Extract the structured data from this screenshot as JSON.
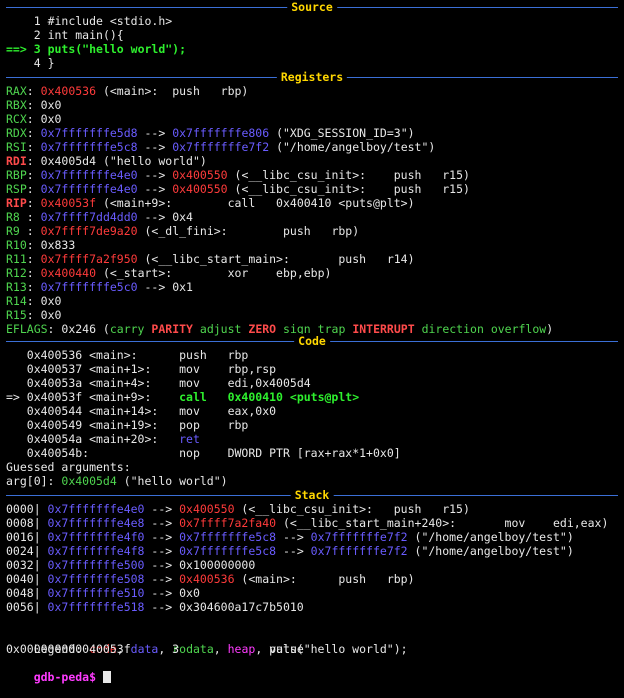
{
  "headers": {
    "source": "Source",
    "registers": "Registers",
    "code": "Code",
    "stack": "Stack"
  },
  "source_lines": [
    {
      "arrow": "",
      "num": "1",
      "text": "#include <stdio.h>"
    },
    {
      "arrow": "",
      "num": "2",
      "text": "int main(){"
    },
    {
      "arrow": "==> ",
      "num": "3",
      "text": "puts(\"hello world\");"
    },
    {
      "arrow": "",
      "num": "4",
      "text": "}"
    }
  ],
  "registers": [
    {
      "name": "RAX",
      "parts": [
        {
          "t": "0x400536",
          "c": "r"
        },
        {
          "t": " (<main>:  push   rbp)",
          "c": "w"
        }
      ]
    },
    {
      "name": "RBX",
      "parts": [
        {
          "t": "0x0",
          "c": "w"
        }
      ]
    },
    {
      "name": "RCX",
      "parts": [
        {
          "t": "0x0",
          "c": "w"
        }
      ]
    },
    {
      "name": "RDX",
      "parts": [
        {
          "t": "0x7fffffffe5d8",
          "c": "b"
        },
        {
          "t": " --> ",
          "c": "w"
        },
        {
          "t": "0x7fffffffe806",
          "c": "b"
        },
        {
          "t": " (\"XDG_SESSION_ID=3\")",
          "c": "w"
        }
      ]
    },
    {
      "name": "RSI",
      "parts": [
        {
          "t": "0x7fffffffe5c8",
          "c": "b"
        },
        {
          "t": " --> ",
          "c": "w"
        },
        {
          "t": "0x7fffffffe7f2",
          "c": "b"
        },
        {
          "t": " (\"/home/angelboy/test\")",
          "c": "w"
        }
      ]
    },
    {
      "name": "RDI",
      "hl": true,
      "parts": [
        {
          "t": "0x4005d4 (\"hello world\")",
          "c": "w"
        }
      ]
    },
    {
      "name": "RBP",
      "parts": [
        {
          "t": "0x7fffffffe4e0",
          "c": "b"
        },
        {
          "t": " --> ",
          "c": "w"
        },
        {
          "t": "0x400550",
          "c": "r"
        },
        {
          "t": " (<__libc_csu_init>:    push   r15)",
          "c": "w"
        }
      ]
    },
    {
      "name": "RSP",
      "parts": [
        {
          "t": "0x7fffffffe4e0",
          "c": "b"
        },
        {
          "t": " --> ",
          "c": "w"
        },
        {
          "t": "0x400550",
          "c": "r"
        },
        {
          "t": " (<__libc_csu_init>:    push   r15)",
          "c": "w"
        }
      ]
    },
    {
      "name": "RIP",
      "hl": true,
      "parts": [
        {
          "t": "0x40053f",
          "c": "r"
        },
        {
          "t": " (<main+9>:        call   0x400410 <puts@plt>)",
          "c": "w"
        }
      ]
    },
    {
      "name": "R8 ",
      "parts": [
        {
          "t": "0x7ffff7dd4dd0",
          "c": "b"
        },
        {
          "t": " --> 0x4",
          "c": "w"
        }
      ]
    },
    {
      "name": "R9 ",
      "parts": [
        {
          "t": "0x7ffff7de9a20",
          "c": "r"
        },
        {
          "t": " (<_dl_fini>:        push   rbp)",
          "c": "w"
        }
      ]
    },
    {
      "name": "R10",
      "parts": [
        {
          "t": "0x833",
          "c": "w"
        }
      ]
    },
    {
      "name": "R11",
      "parts": [
        {
          "t": "0x7ffff7a2f950",
          "c": "r"
        },
        {
          "t": " (<__libc_start_main>:       push   r14)",
          "c": "w"
        }
      ]
    },
    {
      "name": "R12",
      "parts": [
        {
          "t": "0x400440",
          "c": "r"
        },
        {
          "t": " (<_start>:        xor    ebp,ebp)",
          "c": "w"
        }
      ]
    },
    {
      "name": "R13",
      "parts": [
        {
          "t": "0x7fffffffe5c0",
          "c": "b"
        },
        {
          "t": " --> 0x1",
          "c": "w"
        }
      ]
    },
    {
      "name": "R14",
      "parts": [
        {
          "t": "0x0",
          "c": "w"
        }
      ]
    },
    {
      "name": "R15",
      "parts": [
        {
          "t": "0x0",
          "c": "w"
        }
      ]
    }
  ],
  "eflags": {
    "label": "EFLAGS",
    "value": "0x246",
    "flags": [
      {
        "t": "carry",
        "set": false
      },
      {
        "t": "PARITY",
        "set": true
      },
      {
        "t": "adjust",
        "set": false
      },
      {
        "t": "ZERO",
        "set": true
      },
      {
        "t": "sign",
        "set": false
      },
      {
        "t": "trap",
        "set": false
      },
      {
        "t": "INTERRUPT",
        "set": true
      },
      {
        "t": "direction",
        "set": false
      },
      {
        "t": "overflow",
        "set": false
      }
    ]
  },
  "code_lines": [
    {
      "prefix": "   ",
      "addr": "0x400536 <main>:",
      "ins": "push",
      "ops": "rbp",
      "current": false
    },
    {
      "prefix": "   ",
      "addr": "0x400537 <main+1>:",
      "ins": "mov",
      "ops": "rbp,rsp",
      "current": false
    },
    {
      "prefix": "   ",
      "addr": "0x40053a <main+4>:",
      "ins": "mov",
      "ops": "edi,0x4005d4",
      "current": false
    },
    {
      "prefix": "=> ",
      "addr": "0x40053f <main+9>:",
      "ins": "call",
      "ops": "0x400410 <puts@plt>",
      "current": true
    },
    {
      "prefix": "   ",
      "addr": "0x400544 <main+14>:",
      "ins": "mov",
      "ops": "eax,0x0",
      "current": false
    },
    {
      "prefix": "   ",
      "addr": "0x400549 <main+19>:",
      "ins": "pop",
      "ops": "rbp",
      "current": false
    },
    {
      "prefix": "   ",
      "addr": "0x40054a <main+20>:",
      "ins": "ret",
      "ops": "",
      "current": false,
      "blue": true
    },
    {
      "prefix": "   ",
      "addr": "0x40054b:",
      "ins": "nop",
      "ops": "DWORD PTR [rax+rax*1+0x0]",
      "current": false
    }
  ],
  "guessed": {
    "title": "Guessed arguments:",
    "arg_label": "arg[0]: ",
    "arg_addr": "0x4005d4",
    "arg_rest": " (\"hello world\")"
  },
  "stack_lines": [
    {
      "off": "0000|",
      "parts": [
        {
          "t": "0x7fffffffe4e0",
          "c": "b"
        },
        {
          "t": " --> ",
          "c": "w"
        },
        {
          "t": "0x400550",
          "c": "r"
        },
        {
          "t": " (<__libc_csu_init>:   push   r15)",
          "c": "w"
        }
      ]
    },
    {
      "off": "0008|",
      "parts": [
        {
          "t": "0x7fffffffe4e8",
          "c": "b"
        },
        {
          "t": " --> ",
          "c": "w"
        },
        {
          "t": "0x7ffff7a2fa40",
          "c": "r"
        },
        {
          "t": " (<__libc_start_main+240>:       mov    edi,eax)",
          "c": "w"
        }
      ]
    },
    {
      "off": "0016|",
      "parts": [
        {
          "t": "0x7fffffffe4f0",
          "c": "b"
        },
        {
          "t": " --> ",
          "c": "w"
        },
        {
          "t": "0x7fffffffe5c8",
          "c": "b"
        },
        {
          "t": " --> ",
          "c": "w"
        },
        {
          "t": "0x7fffffffe7f2",
          "c": "b"
        },
        {
          "t": " (\"/home/angelboy/test\")",
          "c": "w"
        }
      ]
    },
    {
      "off": "0024|",
      "parts": [
        {
          "t": "0x7fffffffe4f8",
          "c": "b"
        },
        {
          "t": " --> ",
          "c": "w"
        },
        {
          "t": "0x7fffffffe5c8",
          "c": "b"
        },
        {
          "t": " --> ",
          "c": "w"
        },
        {
          "t": "0x7fffffffe7f2",
          "c": "b"
        },
        {
          "t": " (\"/home/angelboy/test\")",
          "c": "w"
        }
      ]
    },
    {
      "off": "0032|",
      "parts": [
        {
          "t": "0x7fffffffe500",
          "c": "b"
        },
        {
          "t": " --> 0x100000000",
          "c": "w"
        }
      ]
    },
    {
      "off": "0040|",
      "parts": [
        {
          "t": "0x7fffffffe508",
          "c": "b"
        },
        {
          "t": " --> ",
          "c": "w"
        },
        {
          "t": "0x400536",
          "c": "r"
        },
        {
          "t": " (<main>:      push   rbp)",
          "c": "w"
        }
      ]
    },
    {
      "off": "0048|",
      "parts": [
        {
          "t": "0x7fffffffe510",
          "c": "b"
        },
        {
          "t": " --> 0x0",
          "c": "w"
        }
      ]
    },
    {
      "off": "0056|",
      "parts": [
        {
          "t": "0x7fffffffe518",
          "c": "b"
        },
        {
          "t": " --> 0x304600a17c7b5010",
          "c": "w"
        }
      ]
    }
  ],
  "legend": {
    "label": "Legend: ",
    "code": "code",
    "data": "data",
    "rodata": "rodata",
    "heap": "heap",
    "value": "value"
  },
  "status_line": "0x000000000040053f      3             puts(\"hello world\");",
  "prompt": "gdb-peda$ ",
  "colors": {
    "red": "#ff3b3b",
    "green": "#4fd54f",
    "blue": "#6a5cff",
    "yellow": "#ffd700",
    "magenta": "#ff3bff",
    "separator": "#3b6fd6"
  }
}
